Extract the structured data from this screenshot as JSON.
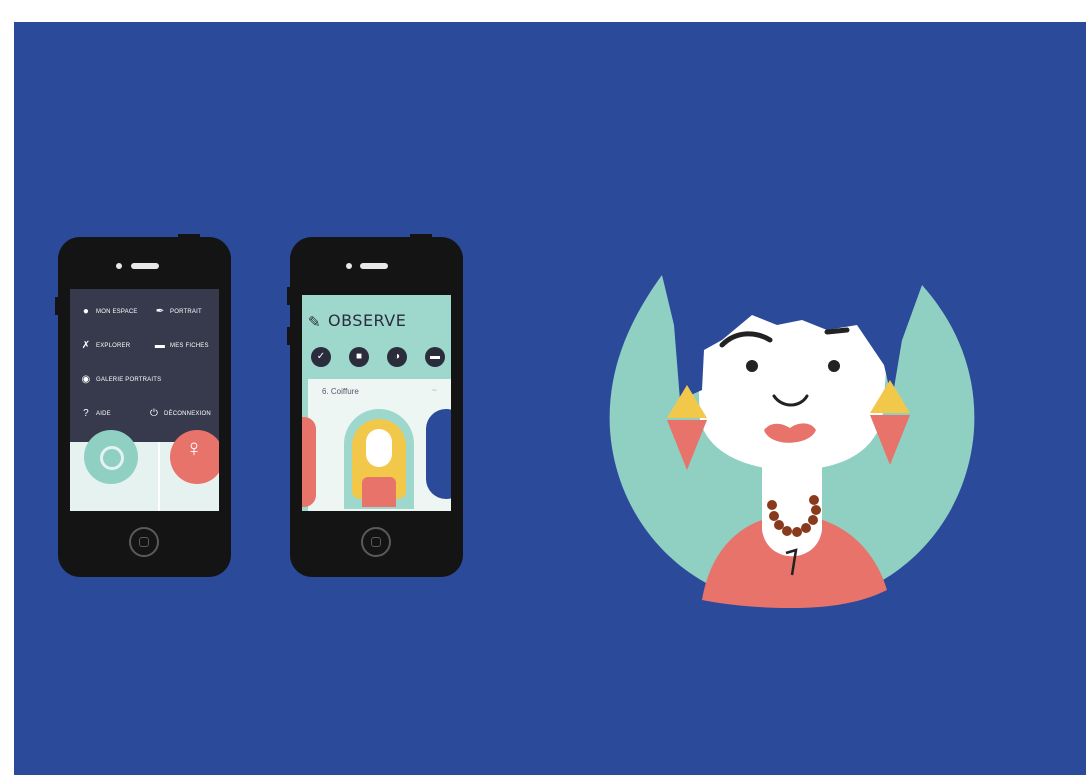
{
  "phone_menu": {
    "items": [
      {
        "icon": "user-icon",
        "label": "MON ESPACE"
      },
      {
        "icon": "pencil-icon",
        "label": "PORTRAIT"
      },
      {
        "icon": "explore-icon",
        "label": "EXPLORER"
      },
      {
        "icon": "folder-icon",
        "label": "MES FICHES"
      },
      {
        "icon": "gallery-icon",
        "label": "GALERIE PORTRAITS"
      },
      {
        "icon": "help-icon",
        "label": "AIDE"
      },
      {
        "icon": "power-icon",
        "label": "DÉCONNEXION"
      }
    ]
  },
  "phone_observe": {
    "title": "OBSERVE",
    "category_icons": [
      "check-icon",
      "shirt-icon",
      "face-icon",
      "accessory-icon"
    ],
    "card_label": "6. Coiffure"
  },
  "colors": {
    "background": "#2b4a9a",
    "teal": "#8fd0c3",
    "coral": "#e8736a",
    "yellow": "#f2c84b",
    "dark": "#373a4d"
  }
}
